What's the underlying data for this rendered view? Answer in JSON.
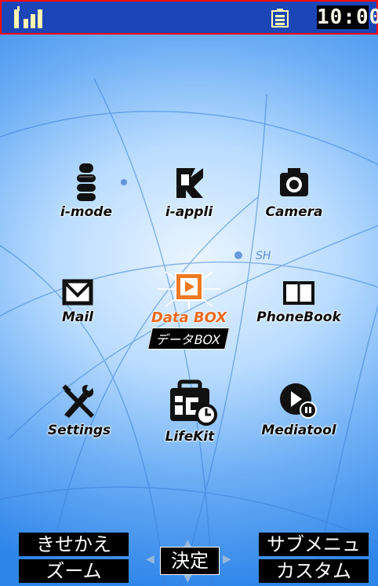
{
  "status_bar": {
    "time": "10:00",
    "signal_icon": "signal-strength-icon",
    "battery_icon": "battery-icon",
    "border_color": "#ff0a0a",
    "bar_color": "#1c45b8"
  },
  "wallpaper": {
    "watermark_text": "SH"
  },
  "menu": {
    "items": [
      {
        "label": "i-mode",
        "icon": "i-mode-icon"
      },
      {
        "label": "i-appli",
        "icon": "i-appli-icon"
      },
      {
        "label": "Camera",
        "icon": "camera-icon"
      },
      {
        "label": "Mail",
        "icon": "mail-icon"
      },
      {
        "label": "Data BOX",
        "label_jp": "データBOX",
        "icon": "databox-icon",
        "selected": true
      },
      {
        "label": "PhoneBook",
        "icon": "phonebook-icon"
      },
      {
        "label": "Settings",
        "icon": "settings-icon"
      },
      {
        "label": "LifeKit",
        "icon": "lifekit-icon"
      },
      {
        "label": "Mediatool",
        "icon": "mediatool-icon"
      }
    ],
    "selected_color": "#f06a1a"
  },
  "softkeys": {
    "top_left": "きせかえ",
    "bottom_left": "ズーム",
    "center": "決定",
    "top_right": "サブメニュー",
    "bottom_right": "カスタム"
  }
}
